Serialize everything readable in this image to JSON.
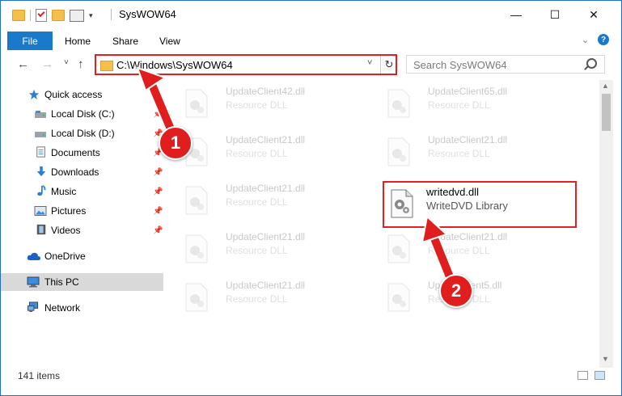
{
  "window": {
    "title": "SysWOW64",
    "controls": {
      "minimize": "—",
      "maximize": "☐",
      "close": "✕"
    }
  },
  "ribbon": {
    "file_label": "File",
    "tabs": [
      "Home",
      "Share",
      "View"
    ],
    "help": "?"
  },
  "navbar": {
    "back_icon": "←",
    "forward_icon": "→",
    "recent_icon": "˅",
    "up_icon": "↑",
    "address": "C:\\Windows\\SysWOW64",
    "address_dropdown": "˅",
    "refresh_icon": "↻",
    "search_placeholder": "Search SysWOW64"
  },
  "sidebar": {
    "items": [
      {
        "label": "Quick access",
        "icon": "star-icon",
        "pinned": false
      },
      {
        "label": "Local Disk (C:)",
        "icon": "drive-icon",
        "pinned": true
      },
      {
        "label": "Local Disk (D:)",
        "icon": "drive-icon",
        "pinned": true
      },
      {
        "label": "Documents",
        "icon": "documents-icon",
        "pinned": true
      },
      {
        "label": "Downloads",
        "icon": "download-icon",
        "pinned": true
      },
      {
        "label": "Music",
        "icon": "music-icon",
        "pinned": true
      },
      {
        "label": "Pictures",
        "icon": "pictures-icon",
        "pinned": true
      },
      {
        "label": "Videos",
        "icon": "videos-icon",
        "pinned": true
      },
      {
        "label": "OneDrive",
        "icon": "cloud-icon",
        "pinned": false
      },
      {
        "label": "This PC",
        "icon": "computer-icon",
        "pinned": false,
        "selected": true
      },
      {
        "label": "Network",
        "icon": "network-icon",
        "pinned": false
      }
    ],
    "pin_glyph": "📌"
  },
  "files": [
    {
      "name": "UpdateClient42.dll",
      "desc": "Resource DLL"
    },
    {
      "name": "UpdateClient65.dll",
      "desc": "Resource DLL"
    },
    {
      "name": "UpdateClient21.dll",
      "desc": "Resource DLL"
    },
    {
      "name": "UpdateClient21.dll",
      "desc": "Resource DLL"
    },
    {
      "name": "UpdateClient21.dll",
      "desc": "Resource DLL"
    },
    {
      "name": "writedvd.dll",
      "desc": "WriteDVD Library",
      "highlighted": true
    },
    {
      "name": "UpdateClient21.dll",
      "desc": "Resource DLL"
    },
    {
      "name": "UpdateClient21.dll",
      "desc": "Resource DLL"
    },
    {
      "name": "UpdateClient21.dll",
      "desc": "Resource DLL"
    },
    {
      "name": "UpdateClient5.dll",
      "desc": "Resource DLL"
    }
  ],
  "status": {
    "count": "141 items"
  },
  "annotations": {
    "step1": "1",
    "step2": "2",
    "accent": "#e01e1e"
  }
}
